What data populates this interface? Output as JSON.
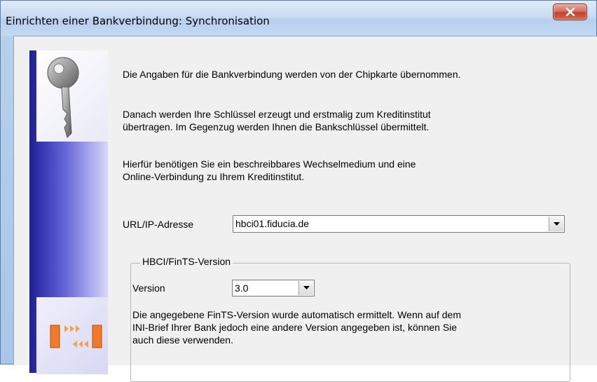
{
  "window": {
    "title": "Einrichten einer Bankverbindung: Synchronisation",
    "close_icon": "close-icon"
  },
  "content": {
    "para1": "Die Angaben für die Bankverbindung werden von der Chipkarte übernommen.",
    "para2_line1": "Danach werden Ihre Schlüssel erzeugt und erstmalig zum Kreditinstitut",
    "para2_line2": "übertragen. Im Gegenzug werden Ihnen die Bankschlüssel übermittelt.",
    "para3_line1": "Hierfür benötigen Sie ein beschreibbares Wechselmedium und eine",
    "para3_line2": "Online-Verbindung zu Ihrem Kreditinstitut."
  },
  "url": {
    "label": "URL/IP-Adresse",
    "value": "hbci01.fiducia.de"
  },
  "hbci_group": {
    "legend": "HBCI/FinTS-Version",
    "version_label": "Version",
    "version_value": "3.0",
    "note_line1": "Die angegebene FinTS-Version wurde automatisch ermittelt. Wenn auf dem",
    "note_line2": "INI-Brief Ihrer Bank jedoch eine andere Version angegeben ist, können Sie",
    "note_line3": "auch diese verwenden."
  },
  "icons": {
    "side_top": "key-icon",
    "side_bottom": "transfer-arrows-icon"
  },
  "colors": {
    "side_panel_dark": "#1e1e8e",
    "close_button": "#c3412c"
  }
}
